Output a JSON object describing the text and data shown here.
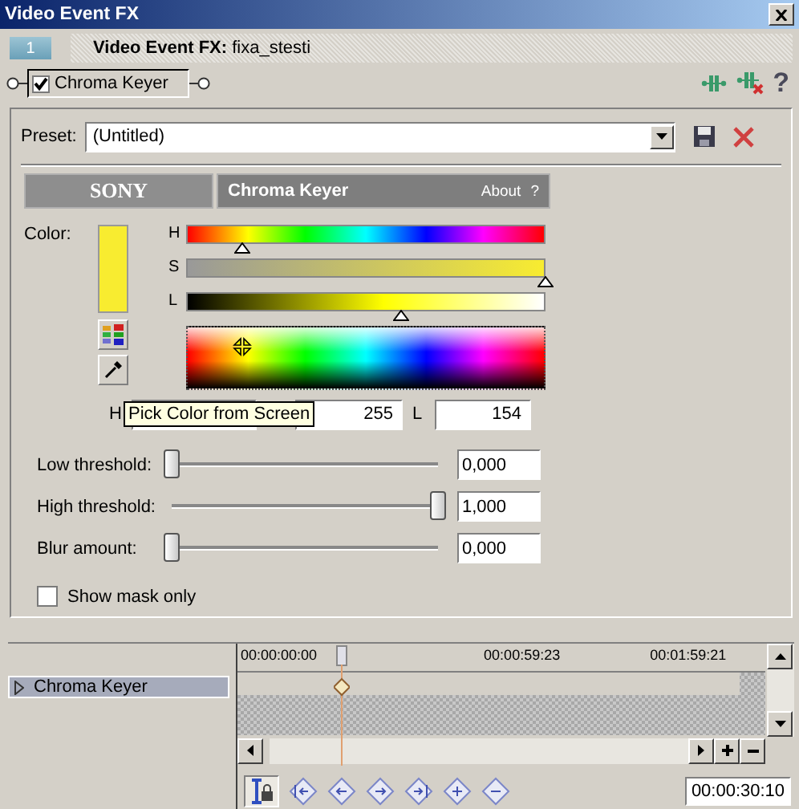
{
  "window": {
    "title": "Video Event FX"
  },
  "header": {
    "tab": "1",
    "title": "**Video Event FX:** fixa_stesti"
  },
  "plugin_chain": [
    {
      "label": "Chroma Keyer",
      "checked": true
    }
  ],
  "toolbar": {
    "help": "?"
  },
  "preset": {
    "label": "Preset:",
    "value": "(Untitled)"
  },
  "banner": {
    "brand": "SONY",
    "plugin": "Chroma Keyer",
    "about": "About",
    "help": "?"
  },
  "color": {
    "label": "Color:",
    "swatch": {
      "color": "#f8ec30"
    },
    "sliders": [
      {
        "label": "H",
        "level": 0.155
      },
      {
        "label": "S",
        "level": 1.0
      },
      {
        "label": "L",
        "level": 0.6
      }
    ],
    "fields": [
      {
        "label": "H"
      },
      {
        "value": "255"
      },
      {
        "label": "L",
        "value": "154"
      }
    ],
    "tooltip": "Pick Color from Screen"
  },
  "parameters": [
    {
      "label": "Low threshold:",
      "level": 0,
      "value": "0,000"
    },
    {
      "label": "High threshold:",
      "level": 1,
      "value": "1,000"
    },
    {
      "label": "Blur amount:",
      "level": 0,
      "value": "0,000"
    }
  ],
  "show_mask_only": {
    "label": "Show mask only",
    "checked": false
  },
  "timeline": {
    "tracks": [
      {
        "label": "Chroma Keyer",
        "selected": true,
        "expanded": false
      }
    ],
    "ruler": [
      "00:00:00:00",
      "00:00:59:23",
      "00:01:59:21"
    ],
    "cursor_time": "00:00:30:10"
  }
}
